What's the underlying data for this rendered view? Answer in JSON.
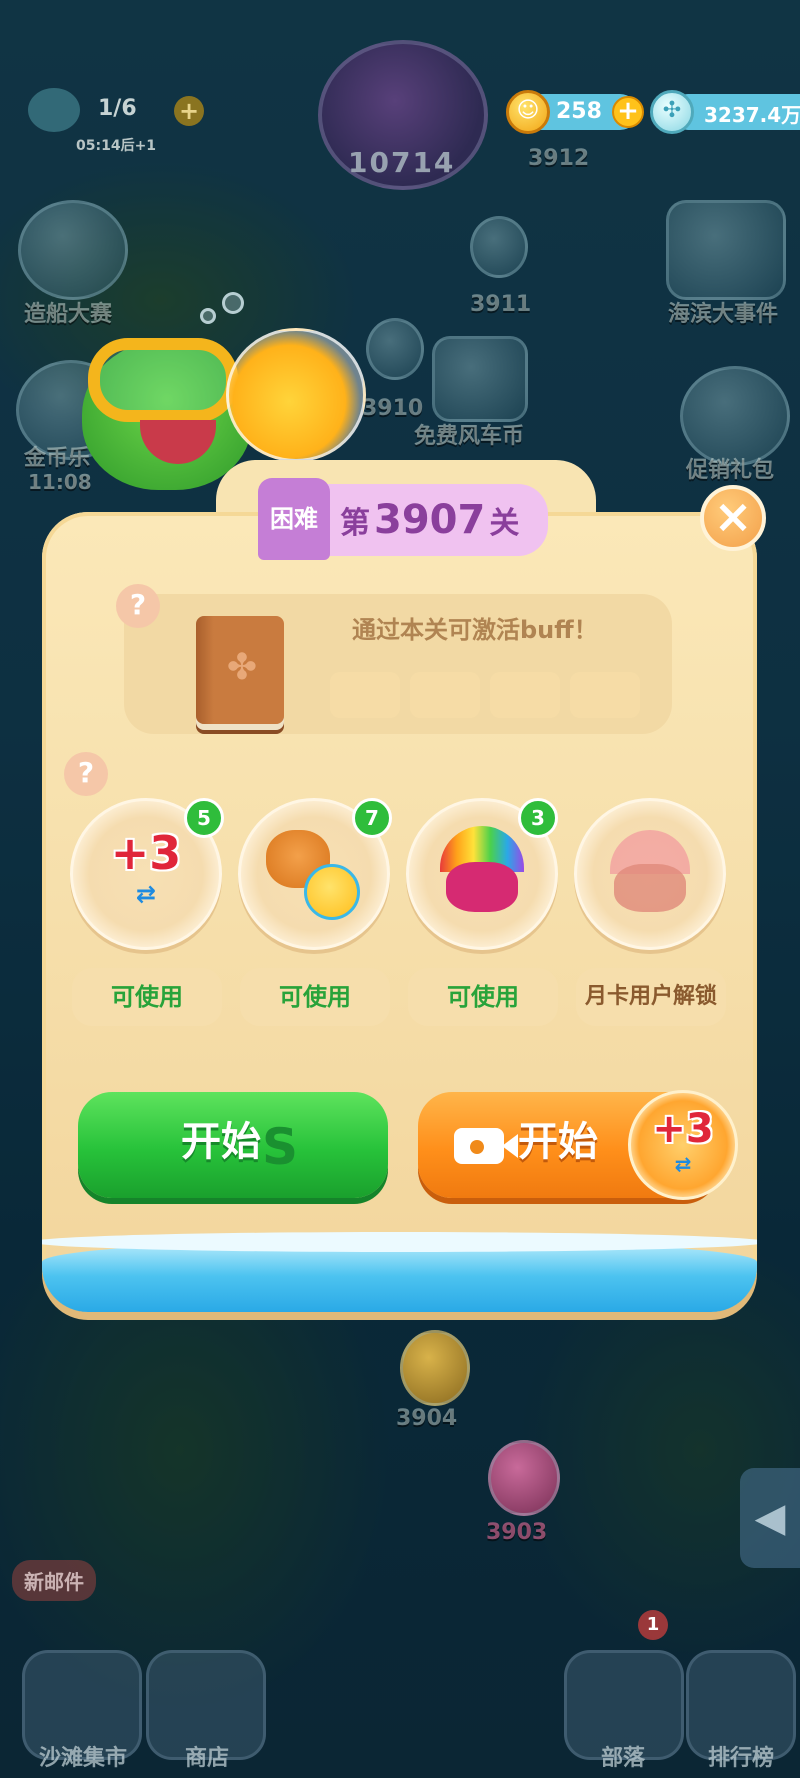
{
  "hud": {
    "lives": "1/6",
    "lives_timer": "05:14后+1",
    "center_level": "10714",
    "coins": "258",
    "gems": "3237.4万"
  },
  "map": {
    "events_left": [
      "造船大赛",
      "金币乐",
      "11:08"
    ],
    "events_right": [
      "海滨大事件",
      "促销礼包"
    ],
    "free_item": "免费风车币",
    "nodes": [
      "3912",
      "3911",
      "3910",
      "3904",
      "3903"
    ],
    "new_mail": "新邮件"
  },
  "bottom_nav": [
    "沙滩集市",
    "商店",
    "部落",
    "排行榜"
  ],
  "bottom_badge": "1",
  "dialog": {
    "difficulty": "困难",
    "title_prefix": "第",
    "level": "3907",
    "title_suffix": "关",
    "close": "×",
    "help": "?",
    "buff_text": "通过本关可激活buff！",
    "boosters": [
      {
        "icon": "plus3-moves-icon",
        "art": "+3",
        "count": "5",
        "status": "可使用"
      },
      {
        "icon": "bear-chick-icon",
        "art": "",
        "count": "7",
        "status": "可使用"
      },
      {
        "icon": "rainbow-owl-icon",
        "art": "",
        "count": "3",
        "status": "可使用"
      },
      {
        "icon": "locked-owl-icon",
        "art": "",
        "count": "",
        "status": "月卡用户解锁"
      }
    ],
    "start_label": "开始",
    "video_start_label": "开始",
    "video_bonus": "+3"
  },
  "colors": {
    "start_green": "#27c23a",
    "start_orange": "#ff8f1a",
    "title_purple": "#8a3f9c",
    "badge_green": "#2fbd3b"
  }
}
